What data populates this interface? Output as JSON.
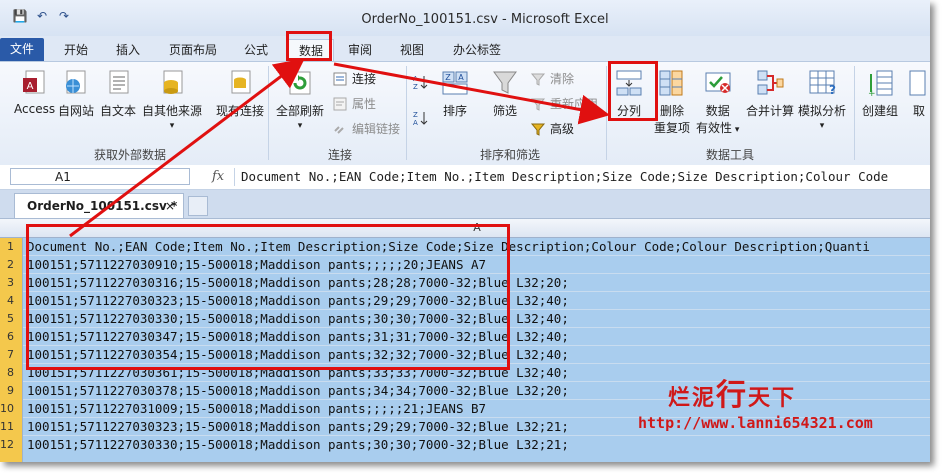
{
  "window": {
    "title": "OrderNo_100151.csv  -  Microsoft Excel"
  },
  "qat": {
    "save": "💾",
    "undo": "↶",
    "redo": "↷"
  },
  "ribbon_tabs": [
    "文件",
    "开始",
    "插入",
    "页面布局",
    "公式",
    "数据",
    "审阅",
    "视图",
    "办公标签"
  ],
  "active_tab": "数据",
  "groups": {
    "get_external": {
      "label": "获取外部数据",
      "buttons": [
        "Access",
        "自网站",
        "自文本",
        "自其他来源",
        "现有连接"
      ]
    },
    "connections": {
      "label": "连接",
      "refresh_all": "全部刷新",
      "connections": "连接",
      "properties": "属性",
      "edit_links": "编辑链接"
    },
    "sort_filter": {
      "label": "排序和筛选",
      "sort": "排序",
      "filter": "筛选",
      "clear": "清除",
      "reapply": "重新应用",
      "advanced": "高级"
    },
    "data_tools": {
      "label": "数据工具",
      "text_to_columns": "分列",
      "remove_dup_1": "删除",
      "remove_dup_2": "重复项",
      "validation_1": "数据",
      "validation_2": "有效性",
      "consolidate": "合并计算",
      "what_if": "模拟分析"
    },
    "outline": {
      "group": "创建组",
      "ungroup": "取"
    }
  },
  "formula_bar": {
    "name_box": "A1",
    "fx": "fx",
    "content": "Document No.;EAN Code;Item No.;Item Description;Size Code;Size Description;Colour Code"
  },
  "doc_tab": {
    "name": "OrderNo_100151.csv *",
    "close": "×"
  },
  "column_header": "A",
  "rows": [
    {
      "num": "1",
      "text": "Document No.;EAN Code;Item No.;Item Description;Size Code;Size Description;Colour Code;Colour Description;Quanti"
    },
    {
      "num": "2",
      "text": "100151;5711227030910;15-500018;Maddison pants;;;;;20;JEANS A7"
    },
    {
      "num": "3",
      "text": "100151;5711227030316;15-500018;Maddison pants;28;28;7000-32;Blue L32;20;"
    },
    {
      "num": "4",
      "text": "100151;5711227030323;15-500018;Maddison pants;29;29;7000-32;Blue L32;40;"
    },
    {
      "num": "5",
      "text": "100151;5711227030330;15-500018;Maddison pants;30;30;7000-32;Blue L32;40;"
    },
    {
      "num": "6",
      "text": "100151;5711227030347;15-500018;Maddison pants;31;31;7000-32;Blue L32;40;"
    },
    {
      "num": "7",
      "text": "100151;5711227030354;15-500018;Maddison pants;32;32;7000-32;Blue L32;40;"
    },
    {
      "num": "8",
      "text": "100151;5711227030361;15-500018;Maddison pants;33;33;7000-32;Blue L32;40;"
    },
    {
      "num": "9",
      "text": "100151;5711227030378;15-500018;Maddison pants;34;34;7000-32;Blue L32;20;"
    },
    {
      "num": "10",
      "text": "100151;5711227031009;15-500018;Maddison pants;;;;;21;JEANS B7"
    },
    {
      "num": "11",
      "text": "100151;5711227030323;15-500018;Maddison pants;29;29;7000-32;Blue L32;21;"
    },
    {
      "num": "12",
      "text": "100151;5711227030330;15-500018;Maddison pants;30;30;7000-32;Blue L32;21;"
    }
  ],
  "watermark": {
    "line1a": "烂泥",
    "line1b": "行",
    "line1c": "天下",
    "url": "http://www.lanni654321.com"
  },
  "colors": {
    "accent": "#2a5aa8",
    "highlight": "#e01010",
    "selection": "#a9cdee",
    "row_header_selected": "#f4c84c"
  }
}
